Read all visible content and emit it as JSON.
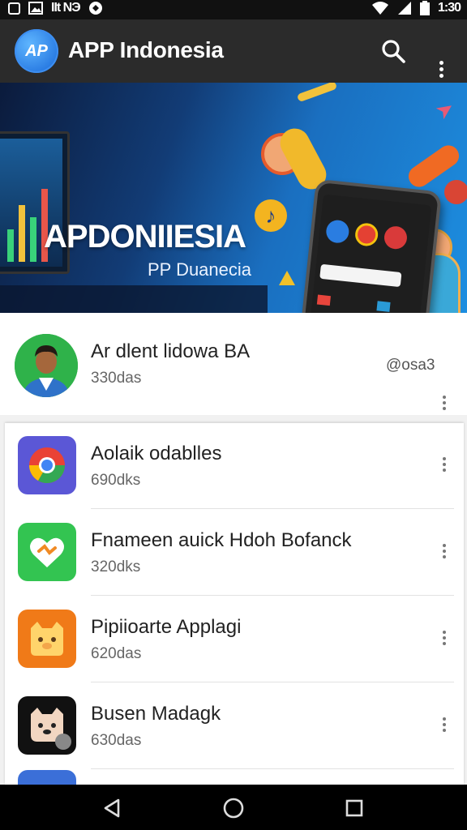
{
  "status_bar": {
    "left_text": "IIt NЭ",
    "time": "1:30",
    "icons": [
      "notification-box-icon",
      "image-icon",
      "signal-icon",
      "vpn-icon",
      "wifi-icon",
      "cell-signal-icon",
      "battery-icon"
    ]
  },
  "app_bar": {
    "logo_text": "AP",
    "title": "APP Indonesia",
    "icons": [
      "search-icon",
      "more-vert-icon"
    ]
  },
  "banner": {
    "title": "APDONIIESIA",
    "subtitle": "PP Duanecia",
    "slide_count": 3,
    "active_slide": 2
  },
  "featured_app": {
    "name": "Ar dlent lidowa BA",
    "meta": "330das",
    "badge": "@osa3",
    "icon": "person-avatar"
  },
  "apps": [
    {
      "name": "Aolaik odablles",
      "meta": "690dks",
      "icon": "chrome-like-icon",
      "icon_color": "#5b57d6"
    },
    {
      "name": "Fnameen auick Hdoh Bofanck",
      "meta": "320dks",
      "icon": "heart-chat-icon",
      "icon_color": "#33c451"
    },
    {
      "name": "Pipiioarte Applagi",
      "meta": "620das",
      "icon": "cat-face-icon",
      "icon_color": "#f07a18"
    },
    {
      "name": "Busen Madagk",
      "meta": "630das",
      "icon": "cat-face-dark-icon",
      "icon_color": "#111111"
    }
  ],
  "nav_bar": {
    "icons": [
      "back-icon",
      "home-icon",
      "recents-icon"
    ]
  }
}
